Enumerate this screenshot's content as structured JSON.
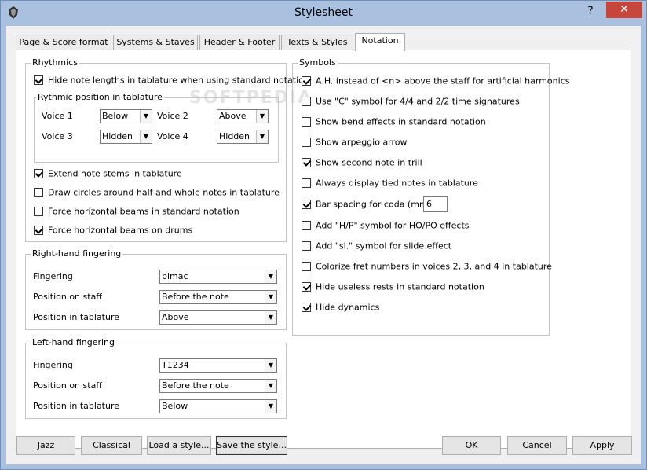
{
  "window": {
    "title": "Stylesheet",
    "help_label": "?",
    "close_label": "✕"
  },
  "tabs": [
    "Page & Score format",
    "Systems & Staves",
    "Header & Footer",
    "Texts & Styles",
    "Notation"
  ],
  "watermark": "SOFTPEDIA",
  "rhythmics": {
    "label": "Rhythmics",
    "hide_note_lengths": {
      "label": "Hide note lengths in tablature when using standard notation",
      "checked": true
    },
    "rythmic_position": {
      "label": "Rythmic position in tablature",
      "voice1_label": "Voice 1",
      "voice1_value": "Below",
      "voice2_label": "Voice 2",
      "voice2_value": "Above",
      "voice3_label": "Voice 3",
      "voice3_value": "Hidden",
      "voice4_label": "Voice 4",
      "voice4_value": "Hidden"
    },
    "extend_note_stems": {
      "label": "Extend note stems in tablature",
      "checked": true
    },
    "draw_circles": {
      "label": "Draw circles around half and whole notes in tablature",
      "checked": false
    },
    "force_horizontal_std": {
      "label": "Force horizontal beams in standard notation",
      "checked": false
    },
    "force_horizontal_drums": {
      "label": "Force horizontal beams on drums",
      "checked": true
    }
  },
  "right_hand": {
    "label": "Right-hand fingering",
    "fingering_label": "Fingering",
    "fingering_value": "pimac",
    "staff_label": "Position on staff",
    "staff_value": "Before the note",
    "tab_label": "Position in tablature",
    "tab_value": "Above"
  },
  "left_hand": {
    "label": "Left-hand fingering",
    "fingering_label": "Fingering",
    "fingering_value": "T1234",
    "staff_label": "Position on staff",
    "staff_value": "Before the note",
    "tab_label": "Position in tablature",
    "tab_value": "Below"
  },
  "symbols": {
    "label": "Symbols",
    "items": [
      {
        "label": "A.H. instead of <n> above the staff for artificial harmonics",
        "checked": true
      },
      {
        "label": "Use \"C\" symbol for 4/4 and 2/2 time signatures",
        "checked": false
      },
      {
        "label": "Show bend effects in standard notation",
        "checked": false
      },
      {
        "label": "Show arpeggio arrow",
        "checked": false
      },
      {
        "label": "Show second note in trill",
        "checked": true
      },
      {
        "label": "Always display tied notes in tablature",
        "checked": false
      },
      {
        "label": "Bar spacing for coda (mm)",
        "checked": true
      },
      {
        "label": "Add \"H/P\" symbol for HO/PO effects",
        "checked": false
      },
      {
        "label": "Add \"sl.\" symbol for slide effect",
        "checked": false
      },
      {
        "label": "Colorize fret numbers in voices 2, 3, and 4 in tablature",
        "checked": false
      },
      {
        "label": "Hide useless rests in standard notation",
        "checked": true
      },
      {
        "label": "Hide dynamics",
        "checked": true
      }
    ],
    "coda_value": "6"
  },
  "buttons": {
    "jazz": "Jazz",
    "classical": "Classical",
    "load": "Load a style...",
    "save": "Save the style...",
    "ok": "OK",
    "cancel": "Cancel",
    "apply": "Apply"
  },
  "icons": {
    "app": "guitar-pro-icon",
    "help": "help-icon",
    "close": "close-icon",
    "dropdown": "dropdown-arrow-icon"
  }
}
